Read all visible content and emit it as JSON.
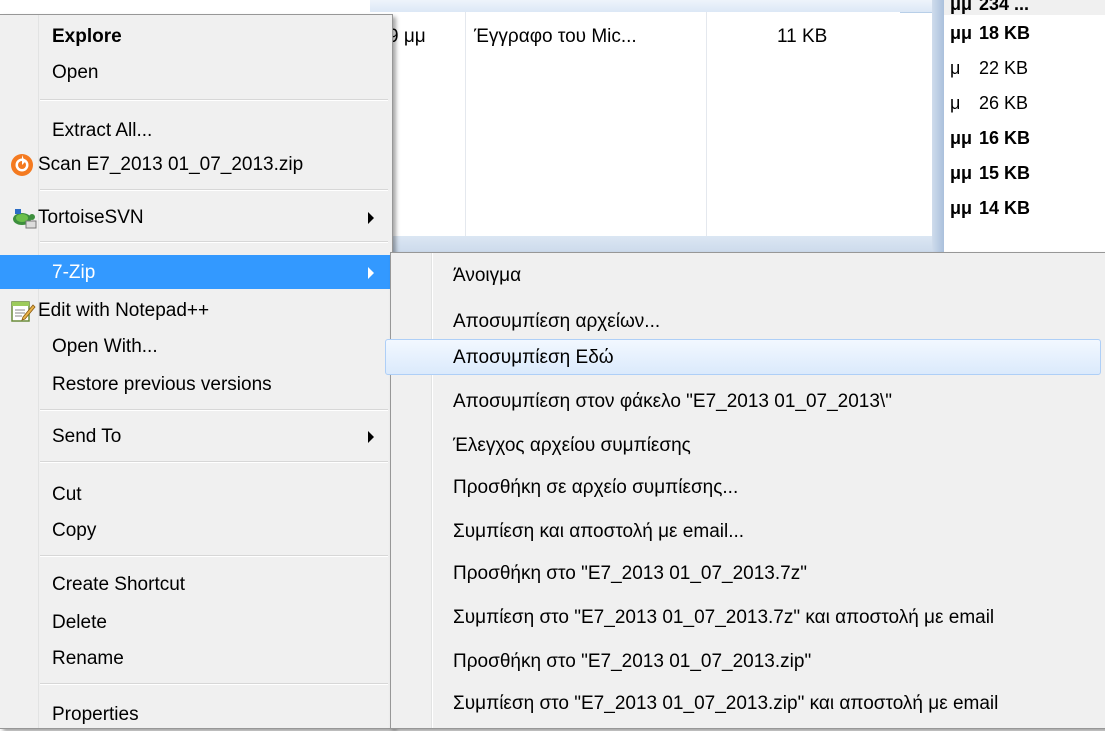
{
  "background": {
    "file_row": {
      "time": "9 μμ",
      "type": "Έγγραφο του Mic...",
      "size": "11 KB"
    },
    "right_list": [
      {
        "prefix": "μμ",
        "size": "234 ...",
        "bold": true
      },
      {
        "prefix": "μμ",
        "size": "18 KB",
        "bold": true
      },
      {
        "prefix": "μ",
        "size": "22 KB",
        "bold": false
      },
      {
        "prefix": "μ",
        "size": "26 KB",
        "bold": false
      },
      {
        "prefix": "μμ",
        "size": "16 KB",
        "bold": true
      },
      {
        "prefix": "μμ",
        "size": "15 KB",
        "bold": true
      },
      {
        "prefix": "μμ",
        "size": "14 KB",
        "bold": true
      }
    ]
  },
  "context_menu": {
    "items": {
      "explore": "Explore",
      "open": "Open",
      "extract_all": "Extract All...",
      "scan": "Scan E7_2013 01_07_2013.zip",
      "tortoisesvn": "TortoiseSVN",
      "seven_zip": "7-Zip",
      "edit_notepadpp": "Edit with Notepad++",
      "open_with": "Open With...",
      "restore_previous": "Restore previous versions",
      "send_to": "Send To",
      "cut": "Cut",
      "copy": "Copy",
      "create_shortcut": "Create Shortcut",
      "delete": "Delete",
      "rename": "Rename",
      "properties": "Properties"
    },
    "selected_item": "7-Zip"
  },
  "submenu_7zip": {
    "items": [
      "Άνοιγμα",
      "Αποσυμπίεση αρχείων...",
      "Αποσυμπίεση Εδώ",
      "Αποσυμπίεση στον φάκελο \"E7_2013 01_07_2013\\\"",
      "Έλεγχος αρχείου συμπίεσης",
      "Προσθήκη σε αρχείο συμπίεσης...",
      "Συμπίεση και αποστολή με email...",
      "Προσθήκη στο \"E7_2013 01_07_2013.7z\"",
      "Συμπίεση στο \"E7_2013 01_07_2013.7z\" και αποστολή με email",
      "Προσθήκη στο \"E7_2013 01_07_2013.zip\"",
      "Συμπίεση στο \"E7_2013 01_07_2013.zip\" και αποστολή με email"
    ],
    "hovered_item": "Αποσυμπίεση Εδώ"
  },
  "colors": {
    "menu_bg": "#f0f0f0",
    "selected_bg": "#3399ff",
    "hover_border": "#aecff7"
  }
}
